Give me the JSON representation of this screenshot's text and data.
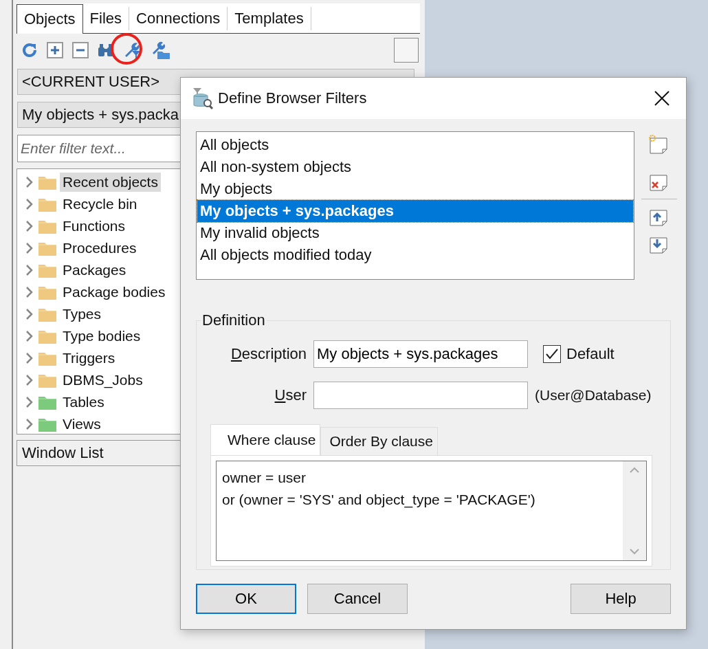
{
  "panel": {
    "tabs": [
      {
        "label": "Objects",
        "selected": true
      },
      {
        "label": "Files",
        "selected": false
      },
      {
        "label": "Connections",
        "selected": false
      },
      {
        "label": "Templates",
        "selected": false
      }
    ],
    "user_select": {
      "value": "<CURRENT USER>"
    },
    "filter_select": {
      "value": "My objects + sys.packa"
    },
    "filter_field": {
      "placeholder": "Enter filter text..."
    },
    "tree": [
      {
        "label": "Recent objects",
        "color": "#efc97f",
        "selected": true
      },
      {
        "label": "Recycle bin",
        "color": "#efc97f",
        "selected": false
      },
      {
        "label": "Functions",
        "color": "#efc97f",
        "selected": false
      },
      {
        "label": "Procedures",
        "color": "#efc97f",
        "selected": false
      },
      {
        "label": "Packages",
        "color": "#efc97f",
        "selected": false
      },
      {
        "label": "Package bodies",
        "color": "#efc97f",
        "selected": false
      },
      {
        "label": "Types",
        "color": "#efc97f",
        "selected": false
      },
      {
        "label": "Type bodies",
        "color": "#efc97f",
        "selected": false
      },
      {
        "label": "Triggers",
        "color": "#efc97f",
        "selected": false
      },
      {
        "label": "DBMS_Jobs",
        "color": "#efc97f",
        "selected": false
      },
      {
        "label": "Tables",
        "color": "#7ccb7c",
        "selected": false
      },
      {
        "label": "Views",
        "color": "#7ccb7c",
        "selected": false
      }
    ],
    "window_list": {
      "label": "Window List"
    }
  },
  "dialog": {
    "title": "Define Browser Filters",
    "filters": [
      {
        "label": "All objects",
        "selected": false
      },
      {
        "label": "All non-system objects",
        "selected": false
      },
      {
        "label": "My objects",
        "selected": false
      },
      {
        "label": "My objects + sys.packages",
        "selected": true
      },
      {
        "label": "My invalid objects",
        "selected": false
      },
      {
        "label": "All objects modified today",
        "selected": false
      }
    ],
    "definition": {
      "title": "Definition",
      "description_label": "Description",
      "description": "My objects + sys.packages",
      "default": {
        "label": "Default",
        "checked": true
      },
      "user_label": "User",
      "user_hint": "(User@Database)",
      "tabs": [
        {
          "label": "Where clause",
          "selected": true
        },
        {
          "label": "Order By clause",
          "selected": false
        }
      ],
      "where_clause": "owner = user\nor (owner = 'SYS' and object_type = 'PACKAGE')"
    },
    "buttons": [
      {
        "label": "OK",
        "focused": true
      },
      {
        "label": "Cancel",
        "focused": false
      },
      {
        "label": "Help",
        "focused": false
      }
    ]
  }
}
